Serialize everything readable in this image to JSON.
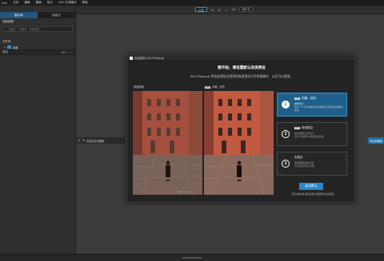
{
  "menubar": {
    "items": [
      "DxO",
      "文件",
      "编辑",
      "图像",
      "显示",
      "DxO 光学模块",
      "帮助"
    ]
  },
  "toolbar": {
    "compare_label": "比较",
    "zoom_ratio": "1:1",
    "zoom_percent": "100 %"
  },
  "sidebar": {
    "tab_browser": "图片库",
    "tab_custom": "自定义",
    "search_label": "搜索图像",
    "search_placeholder": "按图片、关键词、标签搜索...",
    "section_folders": "文件夹",
    "folder_name": "桌面",
    "section_projects": "项目"
  },
  "filterbar": {
    "label": "未选定任何图像"
  },
  "right_partial": {
    "label": "ion",
    "button_label": "导出到磁盘"
  },
  "dialog": {
    "window_title": "欢迎使用 DxO PhotoLab",
    "heading": "要开始，请设置默认改良预设",
    "subtitle": "DxO PhotoLab 将选定预设应用到所有您首次打开的图像中，以后可以更改。",
    "caption_left": "原始图像",
    "caption_right": "风格 - 自然",
    "caption_right_badge": "DxO",
    "watermark": "© Jacques Cecche",
    "options": [
      {
        "num": "1",
        "badge": "DxO",
        "title": "风格 - 自然",
        "desc1": "推荐用户",
        "desc2": "提供一个带有均衡色彩及细腻对比度的起点图像以编辑"
      },
      {
        "num": "2",
        "badge": "DxO",
        "title": "标准校正",
        "desc1": "原生图像光学校正",
        "desc2": "仅作少量调整以保留更多原貌"
      },
      {
        "num": "3",
        "badge": "",
        "title": "无校正",
        "desc1": "保留图像原始外观",
        "desc2": "不应用任何默认调整"
      }
    ],
    "start_button": "启动默认",
    "footnote": "您可以随时在\"偏好设置\"中更改默认改良预设"
  },
  "colors": {
    "accent": "#2a86c8",
    "selected_option": "#1f5f8b",
    "sidebar_tab": "#24567e"
  }
}
